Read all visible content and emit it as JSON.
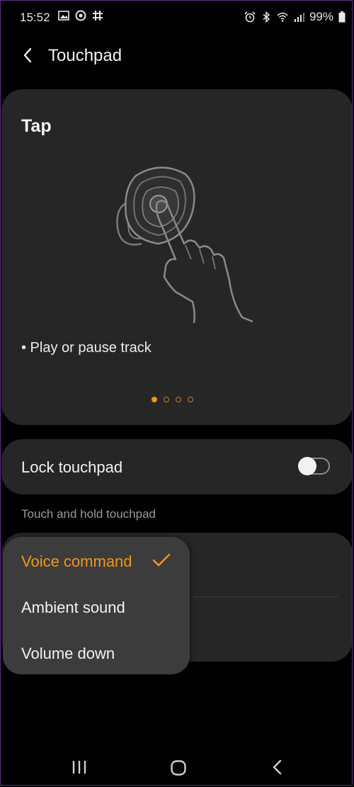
{
  "status_bar": {
    "time": "15:52",
    "battery": "99%",
    "left_icons": [
      "image-icon",
      "circle-icon",
      "slack-icon"
    ],
    "right_icons": [
      "alarm-icon",
      "bluetooth-icon",
      "wifi-icon",
      "signal-icon",
      "battery-icon"
    ]
  },
  "header": {
    "title": "Touchpad"
  },
  "gesture_card": {
    "title": "Tap",
    "description": "• Play or pause track",
    "page_count": 4,
    "active_page": 1
  },
  "lock_touchpad": {
    "label": "Lock touchpad",
    "enabled": false
  },
  "touch_hold": {
    "section_label": "Touch and hold touchpad"
  },
  "dropdown": {
    "options": [
      {
        "label": "Voice command",
        "selected": true
      },
      {
        "label": "Ambient sound",
        "selected": false
      },
      {
        "label": "Volume down",
        "selected": false
      }
    ]
  },
  "colors": {
    "accent": "#f0951f",
    "card": "#262626",
    "menu": "#3c3c3c",
    "background": "#000000"
  },
  "nav_bar": {
    "icons": [
      "recent-apps-icon",
      "home-icon",
      "back-icon"
    ]
  }
}
